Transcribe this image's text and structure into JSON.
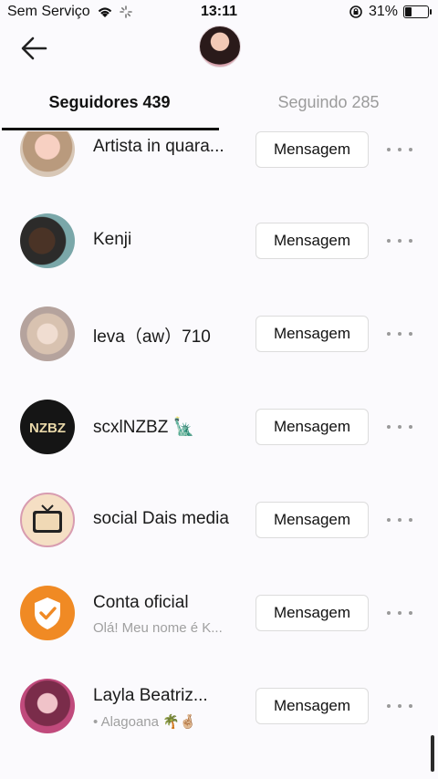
{
  "status_bar": {
    "carrier": "Sem Serviço",
    "time": "13:11",
    "battery_percent": "31%",
    "battery_level": 0.31
  },
  "header": {
    "back_icon": "arrow-left-icon"
  },
  "tabs": [
    {
      "label": "Seguidores 439",
      "active": true
    },
    {
      "label": "Seguindo 285",
      "active": false
    }
  ],
  "followers": [
    {
      "name": "Artista in quara...",
      "subtitle": ""
    },
    {
      "name": "Kenji",
      "subtitle": ""
    },
    {
      "name": "leva（aw）710",
      "subtitle": ""
    },
    {
      "name": "scxlNZBZ 🗽",
      "subtitle": ""
    },
    {
      "name": "social Dais media",
      "subtitle": ""
    },
    {
      "name": "Conta oficial",
      "subtitle": "Olá! Meu nome é K..."
    },
    {
      "name": "Layla Beatriz...",
      "subtitle": "• Alagoana 🌴🤞🏼"
    }
  ],
  "actions": {
    "message_label": "Mensagem",
    "more_icon": "more-horizontal-icon"
  },
  "avatar_texts": {
    "nzbz": "NZBZ"
  },
  "colors": {
    "background": "#fbfafd",
    "inactive_tab": "#9b9b9b",
    "official_badge": "#f08a24"
  }
}
